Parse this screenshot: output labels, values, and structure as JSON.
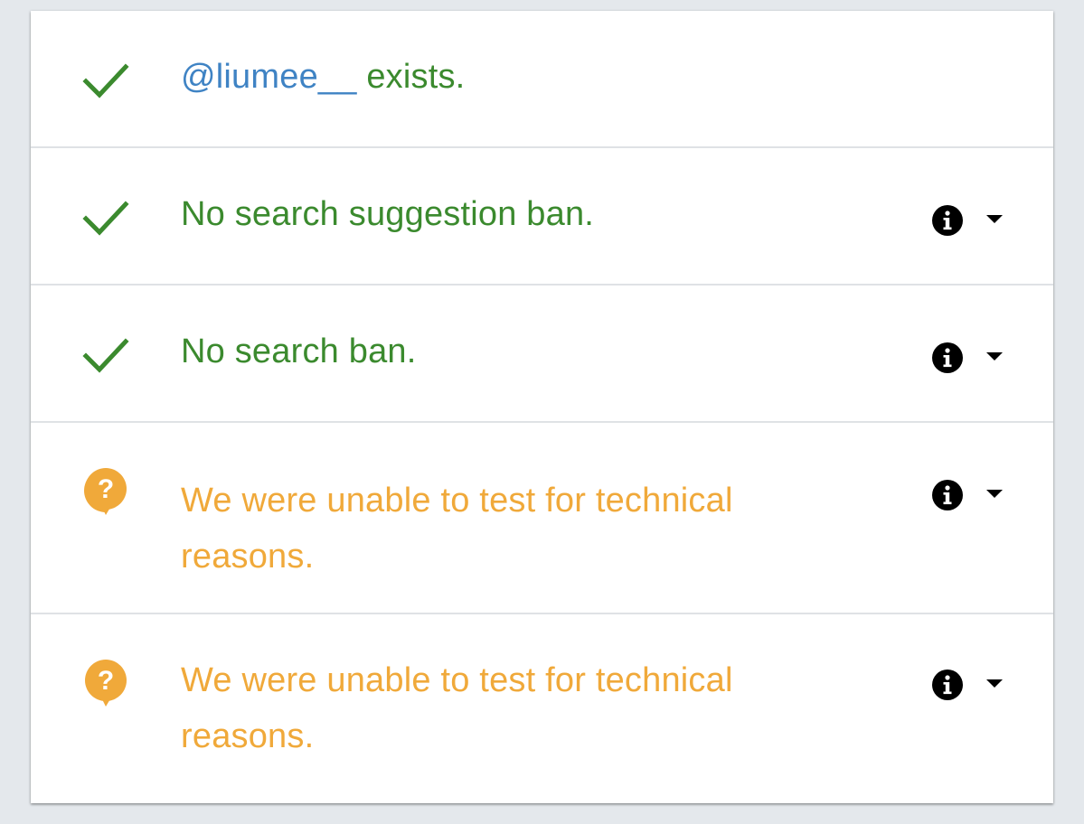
{
  "results": [
    {
      "status": "ok",
      "icon": "check-icon",
      "handle": "@liumee__",
      "text": " exists."
    },
    {
      "status": "ok",
      "icon": "check-icon",
      "text": "No search suggestion ban.",
      "info_icon": "info-icon",
      "toggle_icon": "caret-down-icon"
    },
    {
      "status": "ok",
      "icon": "check-icon",
      "text": "No search ban.",
      "info_icon": "info-icon",
      "toggle_icon": "caret-down-icon"
    },
    {
      "status": "warn",
      "icon": "question-bubble-icon",
      "text": "We were unable to test for technical reasons.",
      "info_icon": "info-icon",
      "toggle_icon": "caret-down-icon"
    },
    {
      "status": "warn",
      "icon": "question-bubble-icon",
      "text": "We were unable to test for technical reasons.",
      "info_icon": "info-icon",
      "toggle_icon": "caret-down-icon"
    }
  ],
  "colors": {
    "ok": "#3b8a2e",
    "warn": "#f0a93a",
    "handle": "#3f83c4",
    "icon_dark": "#000000",
    "divider": "#dfe2e5",
    "background": "#e4e8ec"
  }
}
